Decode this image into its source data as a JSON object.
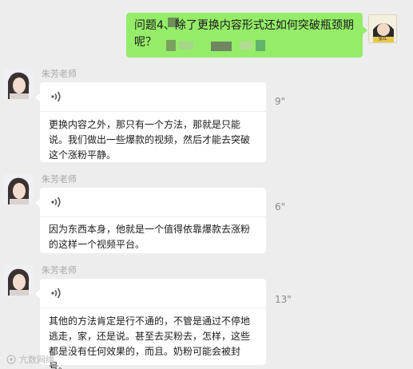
{
  "outgoing": {
    "text": "问题4、除了更换内容形式还如何突破瓶颈期呢？",
    "avatar_label": "张IL"
  },
  "messages": [
    {
      "sender": "朱芳老师",
      "duration": "9\"",
      "transcript": "更换内容之外，那只有一个方法，那就是只能说。我们做出一些爆款的视频，然后才能去突破这个涨粉平静。"
    },
    {
      "sender": "朱芳老师",
      "duration": "6\"",
      "transcript": "因为东西本身，他就是一个值得依靠爆款去涨粉的这样一个视频平台。"
    },
    {
      "sender": "朱芳老师",
      "duration": "13\"",
      "transcript": "其他的方法肯定是行不通的，不管是通过不停地逃走，家，还是说。甚至去买粉去，怎样，这些都是没有任何效果的，而且。奶粉可能会被封号。"
    }
  ],
  "watermark": "亢数网络",
  "icons": {
    "voice": "voice-wave-icon",
    "avatar": "user-avatar-icon"
  },
  "colors": {
    "background": "#ededed",
    "outgoing_bubble": "#95ec69",
    "incoming_bubble": "#ffffff"
  }
}
